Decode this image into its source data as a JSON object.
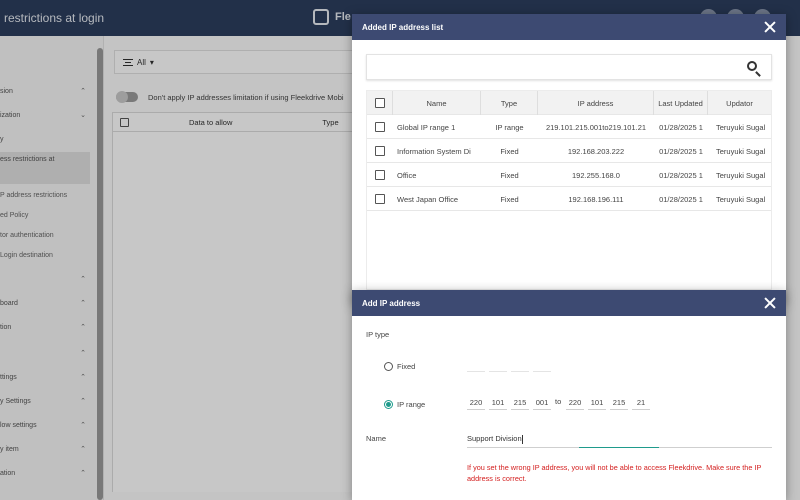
{
  "app": {
    "page_title": "restrictions at login",
    "logo_text": "Fle"
  },
  "sidebar": {
    "items": [
      {
        "label": "sion",
        "chevron": "⌃"
      },
      {
        "label": "ization",
        "chevron": "⌄"
      },
      {
        "label": "y",
        "chevron": ""
      },
      {
        "label": "ess restrictions at",
        "chevron": ""
      },
      {
        "label": "P address restrictions",
        "chevron": ""
      },
      {
        "label": "ed Policy",
        "chevron": ""
      },
      {
        "label": "tor authentication",
        "chevron": ""
      },
      {
        "label": "Login destination",
        "chevron": ""
      },
      {
        "label": "",
        "chevron": "⌃"
      },
      {
        "label": "board",
        "chevron": "⌃"
      },
      {
        "label": "tion",
        "chevron": "⌃"
      },
      {
        "label": "",
        "chevron": "⌃"
      },
      {
        "label": "ttings",
        "chevron": "⌃"
      },
      {
        "label": "y Settings",
        "chevron": "⌃"
      },
      {
        "label": "low settings",
        "chevron": "⌃"
      },
      {
        "label": "y item",
        "chevron": "⌃"
      },
      {
        "label": "ation",
        "chevron": "⌃"
      }
    ]
  },
  "main": {
    "filter_label": "All",
    "toggle_label": "Don't apply IP addresses limitation if using Fleekdrive Mobi",
    "columns": [
      "Data to allow",
      "Type"
    ]
  },
  "ip_list_dialog": {
    "title": "Added IP address list",
    "search_placeholder": "",
    "columns": [
      "Name",
      "Type",
      "IP address",
      "Last Updated",
      "Updator"
    ],
    "rows": [
      {
        "name": "Global IP range 1",
        "type": "IP range",
        "ip": "219.101.215.001to219.101.21",
        "updated": "01/28/2025 1",
        "updator": "Teruyuki Sugal"
      },
      {
        "name": "Information System Di",
        "type": "Fixed",
        "ip": "192.168.203.222",
        "updated": "01/28/2025 1",
        "updator": "Teruyuki Sugal"
      },
      {
        "name": "Office",
        "type": "Fixed",
        "ip": "192.255.168.0",
        "updated": "01/28/2025 1",
        "updator": "Teruyuki Sugal"
      },
      {
        "name": "West Japan Office",
        "type": "Fixed",
        "ip": "192.168.196.111",
        "updated": "01/28/2025 1",
        "updator": "Teruyuki Sugal"
      }
    ]
  },
  "add_dialog": {
    "title": "Add IP address",
    "ip_type_label": "IP type",
    "fixed_label": "Fixed",
    "range_label": "IP range",
    "selected_type": "IP range",
    "range_from": [
      "220",
      "101",
      "215",
      "001"
    ],
    "range_to_label": "to",
    "range_to": [
      "220",
      "101",
      "215",
      "21"
    ],
    "name_label": "Name",
    "name_value": "Support Division",
    "warning": "If you set the wrong IP address, you will not be able to access Fleekdrive. Make sure the IP address is correct."
  },
  "colors": {
    "header_bg": "#2c3e5e",
    "dialog_header": "#3d4a72",
    "accent": "#1f9b8c",
    "warning": "#d42020"
  },
  "icons": [
    "close-icon",
    "search-icon",
    "filter-icon",
    "chevron-icon",
    "checkbox-icon",
    "radio-icon"
  ]
}
